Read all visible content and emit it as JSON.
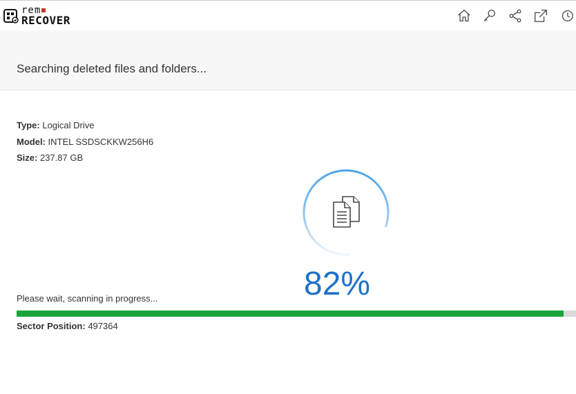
{
  "app": {
    "logo_top": "rem",
    "logo_bottom": "RECOVER"
  },
  "toolbar": {
    "icons": [
      "home-icon",
      "key-icon",
      "share-icon",
      "export-icon",
      "clock-icon"
    ]
  },
  "header": {
    "title": "Searching deleted files and folders..."
  },
  "drive": {
    "type_label": "Type:",
    "type_value": "Logical Drive",
    "model_label": "Model:",
    "model_value": "INTEL SSDSCKKW256H6",
    "size_label": "Size:",
    "size_value": "237.87 GB"
  },
  "progress": {
    "percent_text": "82%",
    "fraction": 0.82,
    "status_text": "Please wait, scanning in progress...",
    "sector_label": "Sector Position:",
    "sector_value": "497364"
  },
  "colors": {
    "accent": "#1e72c9",
    "progress": "#1aa53b",
    "logo_dot": "#c0392b"
  }
}
